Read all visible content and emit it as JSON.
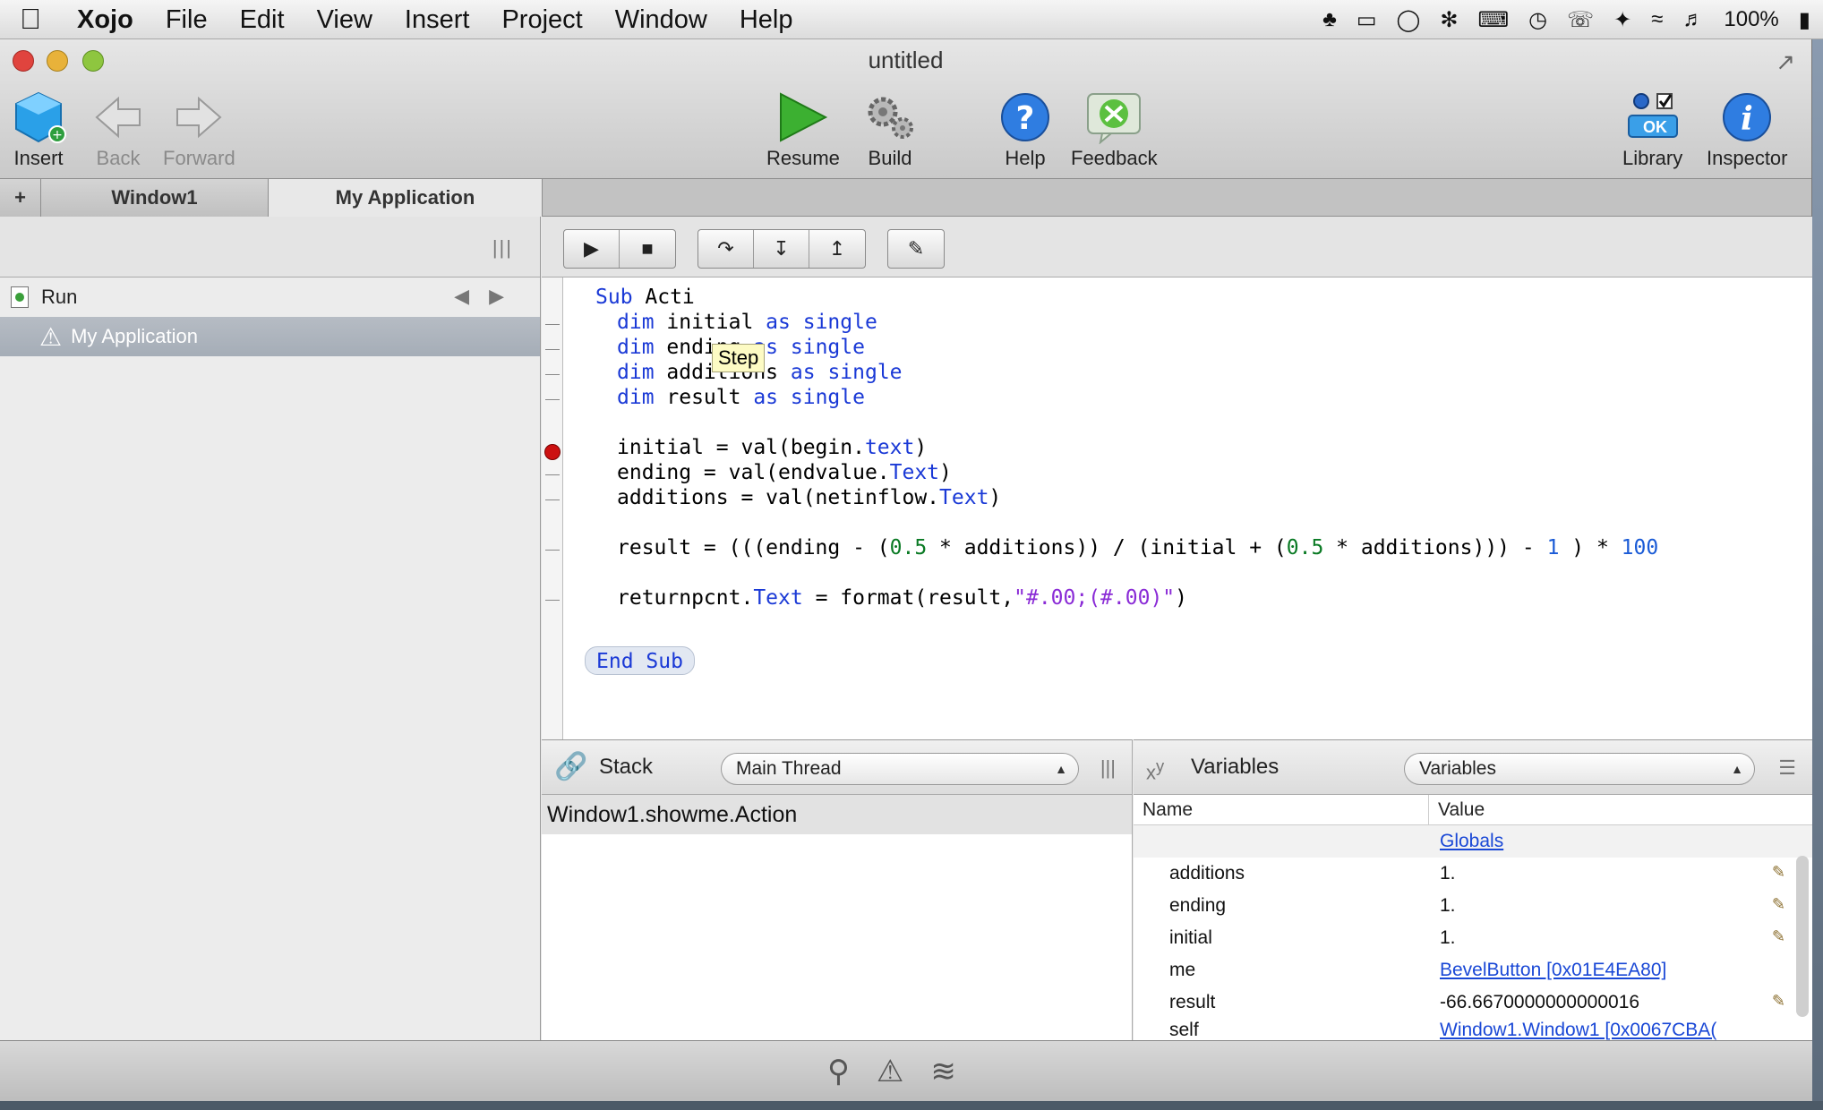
{
  "menubar": {
    "app": "Xojo",
    "items": [
      "File",
      "Edit",
      "View",
      "Insert",
      "Project",
      "Window",
      "Help"
    ],
    "battery": "100%"
  },
  "window": {
    "title": "untitled"
  },
  "toolbar": {
    "insert": "Insert",
    "back": "Back",
    "forward": "Forward",
    "resume": "Resume",
    "build": "Build",
    "help": "Help",
    "feedback": "Feedback",
    "library": "Library",
    "inspector": "Inspector",
    "library_ok": "OK"
  },
  "tabs": {
    "add": "+",
    "window1": "Window1",
    "my_application": "My Application"
  },
  "navigator": {
    "run": "Run",
    "my_application": "My Application"
  },
  "editor": {
    "tooltip": "Step",
    "end_sub": "End Sub"
  },
  "stack": {
    "title": "Stack",
    "thread": "Main Thread",
    "frame": "Window1.showme.Action"
  },
  "variables": {
    "title": "Variables",
    "popup": "Variables",
    "col_name": "Name",
    "col_value": "Value",
    "globals": "Globals",
    "rows": [
      {
        "name": "additions",
        "value": "1."
      },
      {
        "name": "ending",
        "value": "1."
      },
      {
        "name": "initial",
        "value": "1."
      },
      {
        "name": "me",
        "value": "BevelButton [0x01E4EA80]"
      },
      {
        "name": "result",
        "value": "-66.6670000000000016"
      },
      {
        "name": "self",
        "value": "Window1.Window1 [0x0067CBA("
      }
    ]
  }
}
